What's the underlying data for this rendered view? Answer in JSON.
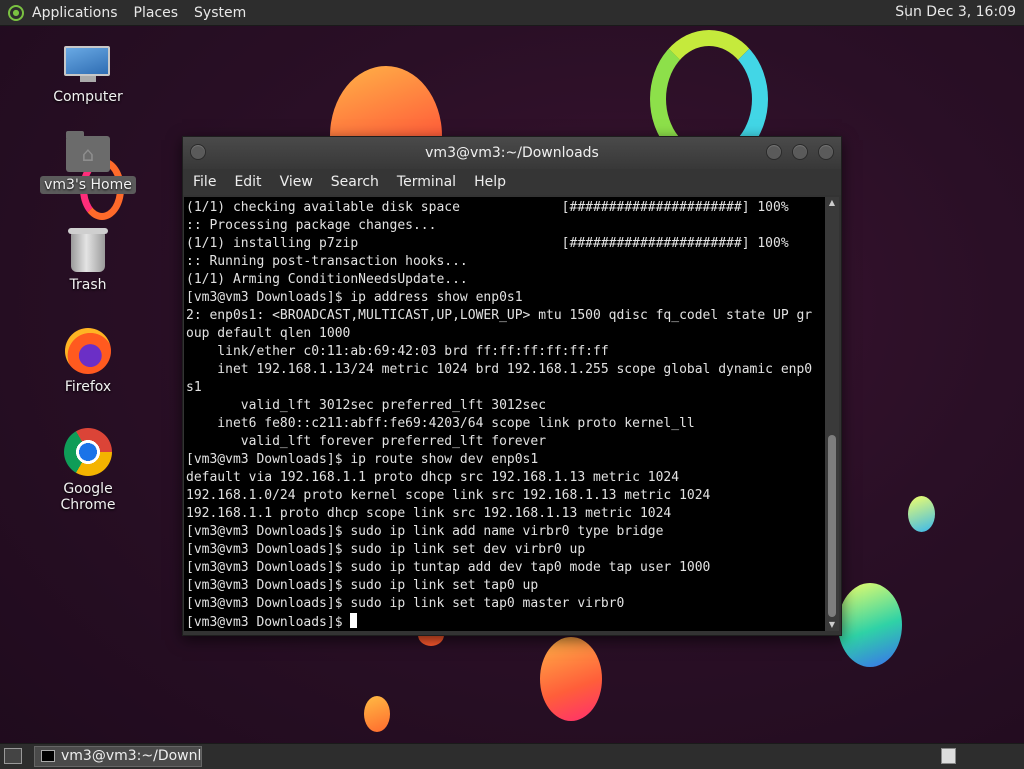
{
  "top_panel": {
    "menu": [
      "Applications",
      "Places",
      "System"
    ],
    "clock": "Sun Dec 3, 16:09"
  },
  "desktop_icons": {
    "computer": "Computer",
    "home": "vm3's Home",
    "trash": "Trash",
    "firefox": "Firefox",
    "chrome": "Google Chrome"
  },
  "terminal": {
    "title": "vm3@vm3:~/Downloads",
    "menu": [
      "File",
      "Edit",
      "View",
      "Search",
      "Terminal",
      "Help"
    ],
    "lines": [
      "(1/1) checking available disk space             [######################] 100%",
      ":: Processing package changes...",
      "(1/1) installing p7zip                          [######################] 100%",
      ":: Running post-transaction hooks...",
      "(1/1) Arming ConditionNeedsUpdate...",
      "[vm3@vm3 Downloads]$ ip address show enp0s1",
      "2: enp0s1: <BROADCAST,MULTICAST,UP,LOWER_UP> mtu 1500 qdisc fq_codel state UP gr",
      "oup default qlen 1000",
      "    link/ether c0:11:ab:69:42:03 brd ff:ff:ff:ff:ff:ff",
      "    inet 192.168.1.13/24 metric 1024 brd 192.168.1.255 scope global dynamic enp0",
      "s1",
      "       valid_lft 3012sec preferred_lft 3012sec",
      "    inet6 fe80::c211:abff:fe69:4203/64 scope link proto kernel_ll",
      "       valid_lft forever preferred_lft forever",
      "[vm3@vm3 Downloads]$ ip route show dev enp0s1",
      "default via 192.168.1.1 proto dhcp src 192.168.1.13 metric 1024",
      "192.168.1.0/24 proto kernel scope link src 192.168.1.13 metric 1024",
      "192.168.1.1 proto dhcp scope link src 192.168.1.13 metric 1024",
      "[vm3@vm3 Downloads]$ sudo ip link add name virbr0 type bridge",
      "[vm3@vm3 Downloads]$ sudo ip link set dev virbr0 up",
      "[vm3@vm3 Downloads]$ sudo ip tuntap add dev tap0 mode tap user 1000",
      "[vm3@vm3 Downloads]$ sudo ip link set tap0 up",
      "[vm3@vm3 Downloads]$ sudo ip link set tap0 master virbr0"
    ],
    "prompt": "[vm3@vm3 Downloads]$ "
  },
  "taskbar": {
    "task_label": "vm3@vm3:~/Downl..."
  }
}
